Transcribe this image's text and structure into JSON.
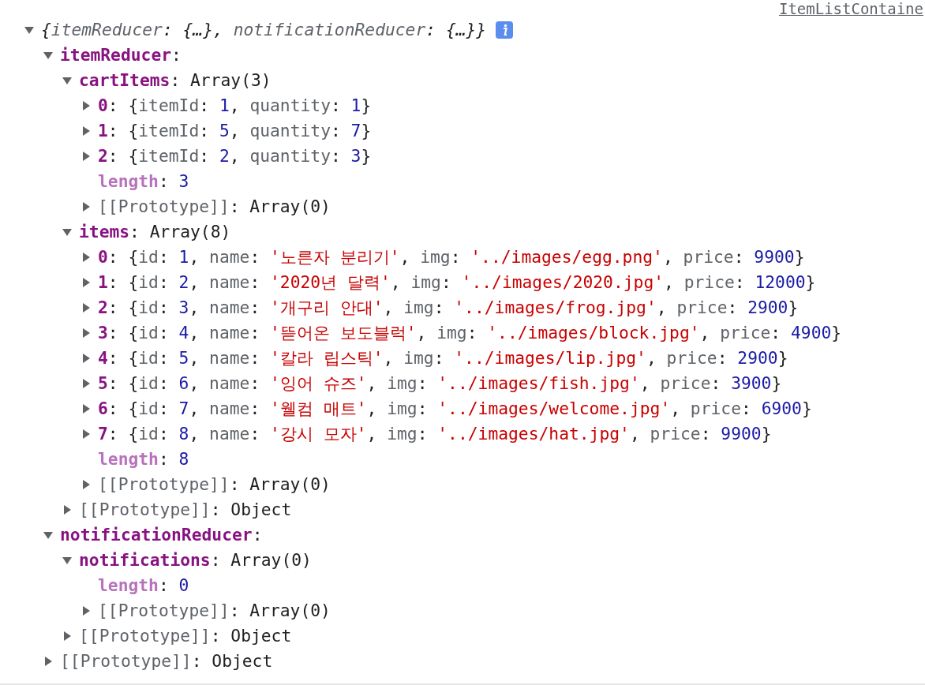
{
  "source_link": "ItemListContaine",
  "tree": {
    "kind": "summary",
    "expanded": true,
    "info": true,
    "value": [
      {
        "kind": "punct",
        "text": "{"
      },
      {
        "kind": "prop",
        "text": "itemReducer"
      },
      {
        "kind": "punct",
        "text": ": {…}, "
      },
      {
        "kind": "prop",
        "text": "notificationReducer"
      },
      {
        "kind": "punct",
        "text": ": {…}}"
      }
    ],
    "children": [
      {
        "kind": "own",
        "key": "itemReducer",
        "expanded": true,
        "value": [
          {
            "kind": "punct",
            "text": ":"
          }
        ],
        "children": [
          {
            "kind": "own",
            "key": "cartItems",
            "expanded": true,
            "value": [
              {
                "kind": "punct",
                "text": ": Array(3)"
              }
            ],
            "children": [
              {
                "kind": "own",
                "key": "0",
                "expanded": false,
                "value": [
                  {
                    "kind": "punct",
                    "text": ": {"
                  },
                  {
                    "kind": "prop",
                    "text": "itemId"
                  },
                  {
                    "kind": "punct",
                    "text": ": "
                  },
                  {
                    "kind": "num",
                    "text": "1"
                  },
                  {
                    "kind": "punct",
                    "text": ", "
                  },
                  {
                    "kind": "prop",
                    "text": "quantity"
                  },
                  {
                    "kind": "punct",
                    "text": ": "
                  },
                  {
                    "kind": "num",
                    "text": "1"
                  },
                  {
                    "kind": "punct",
                    "text": "}"
                  }
                ]
              },
              {
                "kind": "own",
                "key": "1",
                "expanded": false,
                "value": [
                  {
                    "kind": "punct",
                    "text": ": {"
                  },
                  {
                    "kind": "prop",
                    "text": "itemId"
                  },
                  {
                    "kind": "punct",
                    "text": ": "
                  },
                  {
                    "kind": "num",
                    "text": "5"
                  },
                  {
                    "kind": "punct",
                    "text": ", "
                  },
                  {
                    "kind": "prop",
                    "text": "quantity"
                  },
                  {
                    "kind": "punct",
                    "text": ": "
                  },
                  {
                    "kind": "num",
                    "text": "7"
                  },
                  {
                    "kind": "punct",
                    "text": "}"
                  }
                ]
              },
              {
                "kind": "own",
                "key": "2",
                "expanded": false,
                "value": [
                  {
                    "kind": "punct",
                    "text": ": {"
                  },
                  {
                    "kind": "prop",
                    "text": "itemId"
                  },
                  {
                    "kind": "punct",
                    "text": ": "
                  },
                  {
                    "kind": "num",
                    "text": "2"
                  },
                  {
                    "kind": "punct",
                    "text": ", "
                  },
                  {
                    "kind": "prop",
                    "text": "quantity"
                  },
                  {
                    "kind": "punct",
                    "text": ": "
                  },
                  {
                    "kind": "num",
                    "text": "3"
                  },
                  {
                    "kind": "punct",
                    "text": "}"
                  }
                ]
              },
              {
                "kind": "hidden",
                "key": "length",
                "value": [
                  {
                    "kind": "punct",
                    "text": ": "
                  },
                  {
                    "kind": "num",
                    "text": "3"
                  }
                ]
              },
              {
                "kind": "internal",
                "key": "[[Prototype]]",
                "expanded": false,
                "value": [
                  {
                    "kind": "punct",
                    "text": ": Array(0)"
                  }
                ]
              }
            ]
          },
          {
            "kind": "own",
            "key": "items",
            "expanded": true,
            "value": [
              {
                "kind": "punct",
                "text": ": Array(8)"
              }
            ],
            "children": [
              {
                "kind": "own",
                "key": "0",
                "expanded": false,
                "value": [
                  {
                    "kind": "punct",
                    "text": ": {"
                  },
                  {
                    "kind": "prop",
                    "text": "id"
                  },
                  {
                    "kind": "punct",
                    "text": ": "
                  },
                  {
                    "kind": "num",
                    "text": "1"
                  },
                  {
                    "kind": "punct",
                    "text": ", "
                  },
                  {
                    "kind": "prop",
                    "text": "name"
                  },
                  {
                    "kind": "punct",
                    "text": ": "
                  },
                  {
                    "kind": "str",
                    "text": "'노른자 분리기'"
                  },
                  {
                    "kind": "punct",
                    "text": ", "
                  },
                  {
                    "kind": "prop",
                    "text": "img"
                  },
                  {
                    "kind": "punct",
                    "text": ": "
                  },
                  {
                    "kind": "str",
                    "text": "'../images/egg.png'"
                  },
                  {
                    "kind": "punct",
                    "text": ", "
                  },
                  {
                    "kind": "prop",
                    "text": "price"
                  },
                  {
                    "kind": "punct",
                    "text": ": "
                  },
                  {
                    "kind": "num",
                    "text": "9900"
                  },
                  {
                    "kind": "punct",
                    "text": "}"
                  }
                ]
              },
              {
                "kind": "own",
                "key": "1",
                "expanded": false,
                "value": [
                  {
                    "kind": "punct",
                    "text": ": {"
                  },
                  {
                    "kind": "prop",
                    "text": "id"
                  },
                  {
                    "kind": "punct",
                    "text": ": "
                  },
                  {
                    "kind": "num",
                    "text": "2"
                  },
                  {
                    "kind": "punct",
                    "text": ", "
                  },
                  {
                    "kind": "prop",
                    "text": "name"
                  },
                  {
                    "kind": "punct",
                    "text": ": "
                  },
                  {
                    "kind": "str",
                    "text": "'2020년 달력'"
                  },
                  {
                    "kind": "punct",
                    "text": ", "
                  },
                  {
                    "kind": "prop",
                    "text": "img"
                  },
                  {
                    "kind": "punct",
                    "text": ": "
                  },
                  {
                    "kind": "str",
                    "text": "'../images/2020.jpg'"
                  },
                  {
                    "kind": "punct",
                    "text": ", "
                  },
                  {
                    "kind": "prop",
                    "text": "price"
                  },
                  {
                    "kind": "punct",
                    "text": ": "
                  },
                  {
                    "kind": "num",
                    "text": "12000"
                  },
                  {
                    "kind": "punct",
                    "text": "}"
                  }
                ]
              },
              {
                "kind": "own",
                "key": "2",
                "expanded": false,
                "value": [
                  {
                    "kind": "punct",
                    "text": ": {"
                  },
                  {
                    "kind": "prop",
                    "text": "id"
                  },
                  {
                    "kind": "punct",
                    "text": ": "
                  },
                  {
                    "kind": "num",
                    "text": "3"
                  },
                  {
                    "kind": "punct",
                    "text": ", "
                  },
                  {
                    "kind": "prop",
                    "text": "name"
                  },
                  {
                    "kind": "punct",
                    "text": ": "
                  },
                  {
                    "kind": "str",
                    "text": "'개구리 안대'"
                  },
                  {
                    "kind": "punct",
                    "text": ", "
                  },
                  {
                    "kind": "prop",
                    "text": "img"
                  },
                  {
                    "kind": "punct",
                    "text": ": "
                  },
                  {
                    "kind": "str",
                    "text": "'../images/frog.jpg'"
                  },
                  {
                    "kind": "punct",
                    "text": ", "
                  },
                  {
                    "kind": "prop",
                    "text": "price"
                  },
                  {
                    "kind": "punct",
                    "text": ": "
                  },
                  {
                    "kind": "num",
                    "text": "2900"
                  },
                  {
                    "kind": "punct",
                    "text": "}"
                  }
                ]
              },
              {
                "kind": "own",
                "key": "3",
                "expanded": false,
                "value": [
                  {
                    "kind": "punct",
                    "text": ": {"
                  },
                  {
                    "kind": "prop",
                    "text": "id"
                  },
                  {
                    "kind": "punct",
                    "text": ": "
                  },
                  {
                    "kind": "num",
                    "text": "4"
                  },
                  {
                    "kind": "punct",
                    "text": ", "
                  },
                  {
                    "kind": "prop",
                    "text": "name"
                  },
                  {
                    "kind": "punct",
                    "text": ": "
                  },
                  {
                    "kind": "str",
                    "text": "'뜯어온 보도블럭'"
                  },
                  {
                    "kind": "punct",
                    "text": ", "
                  },
                  {
                    "kind": "prop",
                    "text": "img"
                  },
                  {
                    "kind": "punct",
                    "text": ": "
                  },
                  {
                    "kind": "str",
                    "text": "'../images/block.jpg'"
                  },
                  {
                    "kind": "punct",
                    "text": ", "
                  },
                  {
                    "kind": "prop",
                    "text": "price"
                  },
                  {
                    "kind": "punct",
                    "text": ": "
                  },
                  {
                    "kind": "num",
                    "text": "4900"
                  },
                  {
                    "kind": "punct",
                    "text": "}"
                  }
                ]
              },
              {
                "kind": "own",
                "key": "4",
                "expanded": false,
                "value": [
                  {
                    "kind": "punct",
                    "text": ": {"
                  },
                  {
                    "kind": "prop",
                    "text": "id"
                  },
                  {
                    "kind": "punct",
                    "text": ": "
                  },
                  {
                    "kind": "num",
                    "text": "5"
                  },
                  {
                    "kind": "punct",
                    "text": ", "
                  },
                  {
                    "kind": "prop",
                    "text": "name"
                  },
                  {
                    "kind": "punct",
                    "text": ": "
                  },
                  {
                    "kind": "str",
                    "text": "'칼라 립스틱'"
                  },
                  {
                    "kind": "punct",
                    "text": ", "
                  },
                  {
                    "kind": "prop",
                    "text": "img"
                  },
                  {
                    "kind": "punct",
                    "text": ": "
                  },
                  {
                    "kind": "str",
                    "text": "'../images/lip.jpg'"
                  },
                  {
                    "kind": "punct",
                    "text": ", "
                  },
                  {
                    "kind": "prop",
                    "text": "price"
                  },
                  {
                    "kind": "punct",
                    "text": ": "
                  },
                  {
                    "kind": "num",
                    "text": "2900"
                  },
                  {
                    "kind": "punct",
                    "text": "}"
                  }
                ]
              },
              {
                "kind": "own",
                "key": "5",
                "expanded": false,
                "value": [
                  {
                    "kind": "punct",
                    "text": ": {"
                  },
                  {
                    "kind": "prop",
                    "text": "id"
                  },
                  {
                    "kind": "punct",
                    "text": ": "
                  },
                  {
                    "kind": "num",
                    "text": "6"
                  },
                  {
                    "kind": "punct",
                    "text": ", "
                  },
                  {
                    "kind": "prop",
                    "text": "name"
                  },
                  {
                    "kind": "punct",
                    "text": ": "
                  },
                  {
                    "kind": "str",
                    "text": "'잉어 슈즈'"
                  },
                  {
                    "kind": "punct",
                    "text": ", "
                  },
                  {
                    "kind": "prop",
                    "text": "img"
                  },
                  {
                    "kind": "punct",
                    "text": ": "
                  },
                  {
                    "kind": "str",
                    "text": "'../images/fish.jpg'"
                  },
                  {
                    "kind": "punct",
                    "text": ", "
                  },
                  {
                    "kind": "prop",
                    "text": "price"
                  },
                  {
                    "kind": "punct",
                    "text": ": "
                  },
                  {
                    "kind": "num",
                    "text": "3900"
                  },
                  {
                    "kind": "punct",
                    "text": "}"
                  }
                ]
              },
              {
                "kind": "own",
                "key": "6",
                "expanded": false,
                "value": [
                  {
                    "kind": "punct",
                    "text": ": {"
                  },
                  {
                    "kind": "prop",
                    "text": "id"
                  },
                  {
                    "kind": "punct",
                    "text": ": "
                  },
                  {
                    "kind": "num",
                    "text": "7"
                  },
                  {
                    "kind": "punct",
                    "text": ", "
                  },
                  {
                    "kind": "prop",
                    "text": "name"
                  },
                  {
                    "kind": "punct",
                    "text": ": "
                  },
                  {
                    "kind": "str",
                    "text": "'웰컴 매트'"
                  },
                  {
                    "kind": "punct",
                    "text": ", "
                  },
                  {
                    "kind": "prop",
                    "text": "img"
                  },
                  {
                    "kind": "punct",
                    "text": ": "
                  },
                  {
                    "kind": "str",
                    "text": "'../images/welcome.jpg'"
                  },
                  {
                    "kind": "punct",
                    "text": ", "
                  },
                  {
                    "kind": "prop",
                    "text": "price"
                  },
                  {
                    "kind": "punct",
                    "text": ": "
                  },
                  {
                    "kind": "num",
                    "text": "6900"
                  },
                  {
                    "kind": "punct",
                    "text": "}"
                  }
                ]
              },
              {
                "kind": "own",
                "key": "7",
                "expanded": false,
                "value": [
                  {
                    "kind": "punct",
                    "text": ": {"
                  },
                  {
                    "kind": "prop",
                    "text": "id"
                  },
                  {
                    "kind": "punct",
                    "text": ": "
                  },
                  {
                    "kind": "num",
                    "text": "8"
                  },
                  {
                    "kind": "punct",
                    "text": ", "
                  },
                  {
                    "kind": "prop",
                    "text": "name"
                  },
                  {
                    "kind": "punct",
                    "text": ": "
                  },
                  {
                    "kind": "str",
                    "text": "'강시 모자'"
                  },
                  {
                    "kind": "punct",
                    "text": ", "
                  },
                  {
                    "kind": "prop",
                    "text": "img"
                  },
                  {
                    "kind": "punct",
                    "text": ": "
                  },
                  {
                    "kind": "str",
                    "text": "'../images/hat.jpg'"
                  },
                  {
                    "kind": "punct",
                    "text": ", "
                  },
                  {
                    "kind": "prop",
                    "text": "price"
                  },
                  {
                    "kind": "punct",
                    "text": ": "
                  },
                  {
                    "kind": "num",
                    "text": "9900"
                  },
                  {
                    "kind": "punct",
                    "text": "}"
                  }
                ]
              },
              {
                "kind": "hidden",
                "key": "length",
                "value": [
                  {
                    "kind": "punct",
                    "text": ": "
                  },
                  {
                    "kind": "num",
                    "text": "8"
                  }
                ]
              },
              {
                "kind": "internal",
                "key": "[[Prototype]]",
                "expanded": false,
                "value": [
                  {
                    "kind": "punct",
                    "text": ": Array(0)"
                  }
                ]
              }
            ]
          },
          {
            "kind": "internal",
            "key": "[[Prototype]]",
            "expanded": false,
            "value": [
              {
                "kind": "punct",
                "text": ": Object"
              }
            ]
          }
        ]
      },
      {
        "kind": "own",
        "key": "notificationReducer",
        "expanded": true,
        "value": [
          {
            "kind": "punct",
            "text": ":"
          }
        ],
        "children": [
          {
            "kind": "own",
            "key": "notifications",
            "expanded": true,
            "value": [
              {
                "kind": "punct",
                "text": ": Array(0)"
              }
            ],
            "children": [
              {
                "kind": "hidden",
                "key": "length",
                "value": [
                  {
                    "kind": "punct",
                    "text": ": "
                  },
                  {
                    "kind": "num",
                    "text": "0"
                  }
                ]
              },
              {
                "kind": "internal",
                "key": "[[Prototype]]",
                "expanded": false,
                "value": [
                  {
                    "kind": "punct",
                    "text": ": Array(0)"
                  }
                ]
              }
            ]
          },
          {
            "kind": "internal",
            "key": "[[Prototype]]",
            "expanded": false,
            "value": [
              {
                "kind": "punct",
                "text": ": Object"
              }
            ]
          }
        ]
      },
      {
        "kind": "internal",
        "key": "[[Prototype]]",
        "expanded": false,
        "value": [
          {
            "kind": "punct",
            "text": ": Object"
          }
        ]
      }
    ]
  }
}
